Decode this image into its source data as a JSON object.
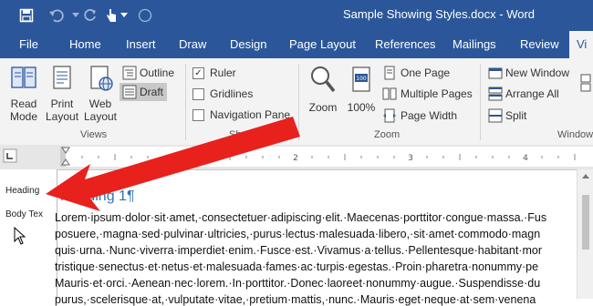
{
  "window": {
    "title": "Sample Showing Styles.docx - Word"
  },
  "qat": {
    "save_icon": "save-icon",
    "undo_icon": "undo-icon",
    "redo_icon": "redo-icon",
    "touch_icon": "touch-mode-icon"
  },
  "tabs": [
    {
      "label": "File"
    },
    {
      "label": "Home"
    },
    {
      "label": "Insert"
    },
    {
      "label": "Draw"
    },
    {
      "label": "Design"
    },
    {
      "label": "Page Layout"
    },
    {
      "label": "References"
    },
    {
      "label": "Mailings"
    },
    {
      "label": "Review"
    },
    {
      "label": "Vi"
    }
  ],
  "ribbon": {
    "views": {
      "label": "Views",
      "read_mode": "Read Mode",
      "read_mode_l1": "Read",
      "read_mode_l2": "Mode",
      "print_layout_l1": "Print",
      "print_layout_l2": "Layout",
      "web_layout_l1": "Web",
      "web_layout_l2": "Layout",
      "outline": "Outline",
      "draft": "Draft"
    },
    "show": {
      "label": "Show",
      "ruler": "Ruler",
      "ruler_checked": true,
      "gridlines": "Gridlines",
      "navigation_pane": "Navigation Pane"
    },
    "zoom": {
      "label": "Zoom",
      "zoom": "Zoom",
      "hundred": "100%",
      "one_page": "One Page",
      "multiple_pages": "Multiple Pages",
      "page_width": "Page Width"
    },
    "window": {
      "label": "Window",
      "new_window": "New Window",
      "arrange_all": "Arrange All",
      "split": "Split"
    }
  },
  "style_area": {
    "heading": "Heading",
    "body": "Body Tex"
  },
  "document": {
    "heading": "Heading 1¶",
    "lines": [
      "Lorem·ipsum·dolor·sit·amet,·consectetuer·adipiscing·elit.·Maecenas·porttitor·congue·massa.·Fus",
      "posuere,·magna·sed·pulvinar·ultricies,·purus·lectus·malesuada·libero,·sit·amet·commodo·magn",
      "quis·urna.·Nunc·viverra·imperdiet·enim.·Fusce·est.·Vivamus·a·tellus.·Pellentesque·habitant·mor",
      "tristique·senectus·et·netus·et·malesuada·fames·ac·turpis·egestas.·Proin·pharetra·nonummy·pe",
      "Mauris·et·orci.·Aenean·nec·lorem.·In·porttitor.·Donec·laoreet·nonummy·augue.·Suspendisse·du",
      "purus,·scelerisque·at,·vulputate·vitae,·pretium·mattis,·nunc.·Mauris·eget·neque·at·sem·venena"
    ]
  },
  "colors": {
    "word_blue": "#2b579a",
    "arrow_red": "#e8211d",
    "heading_blue": "#2e74b5"
  }
}
